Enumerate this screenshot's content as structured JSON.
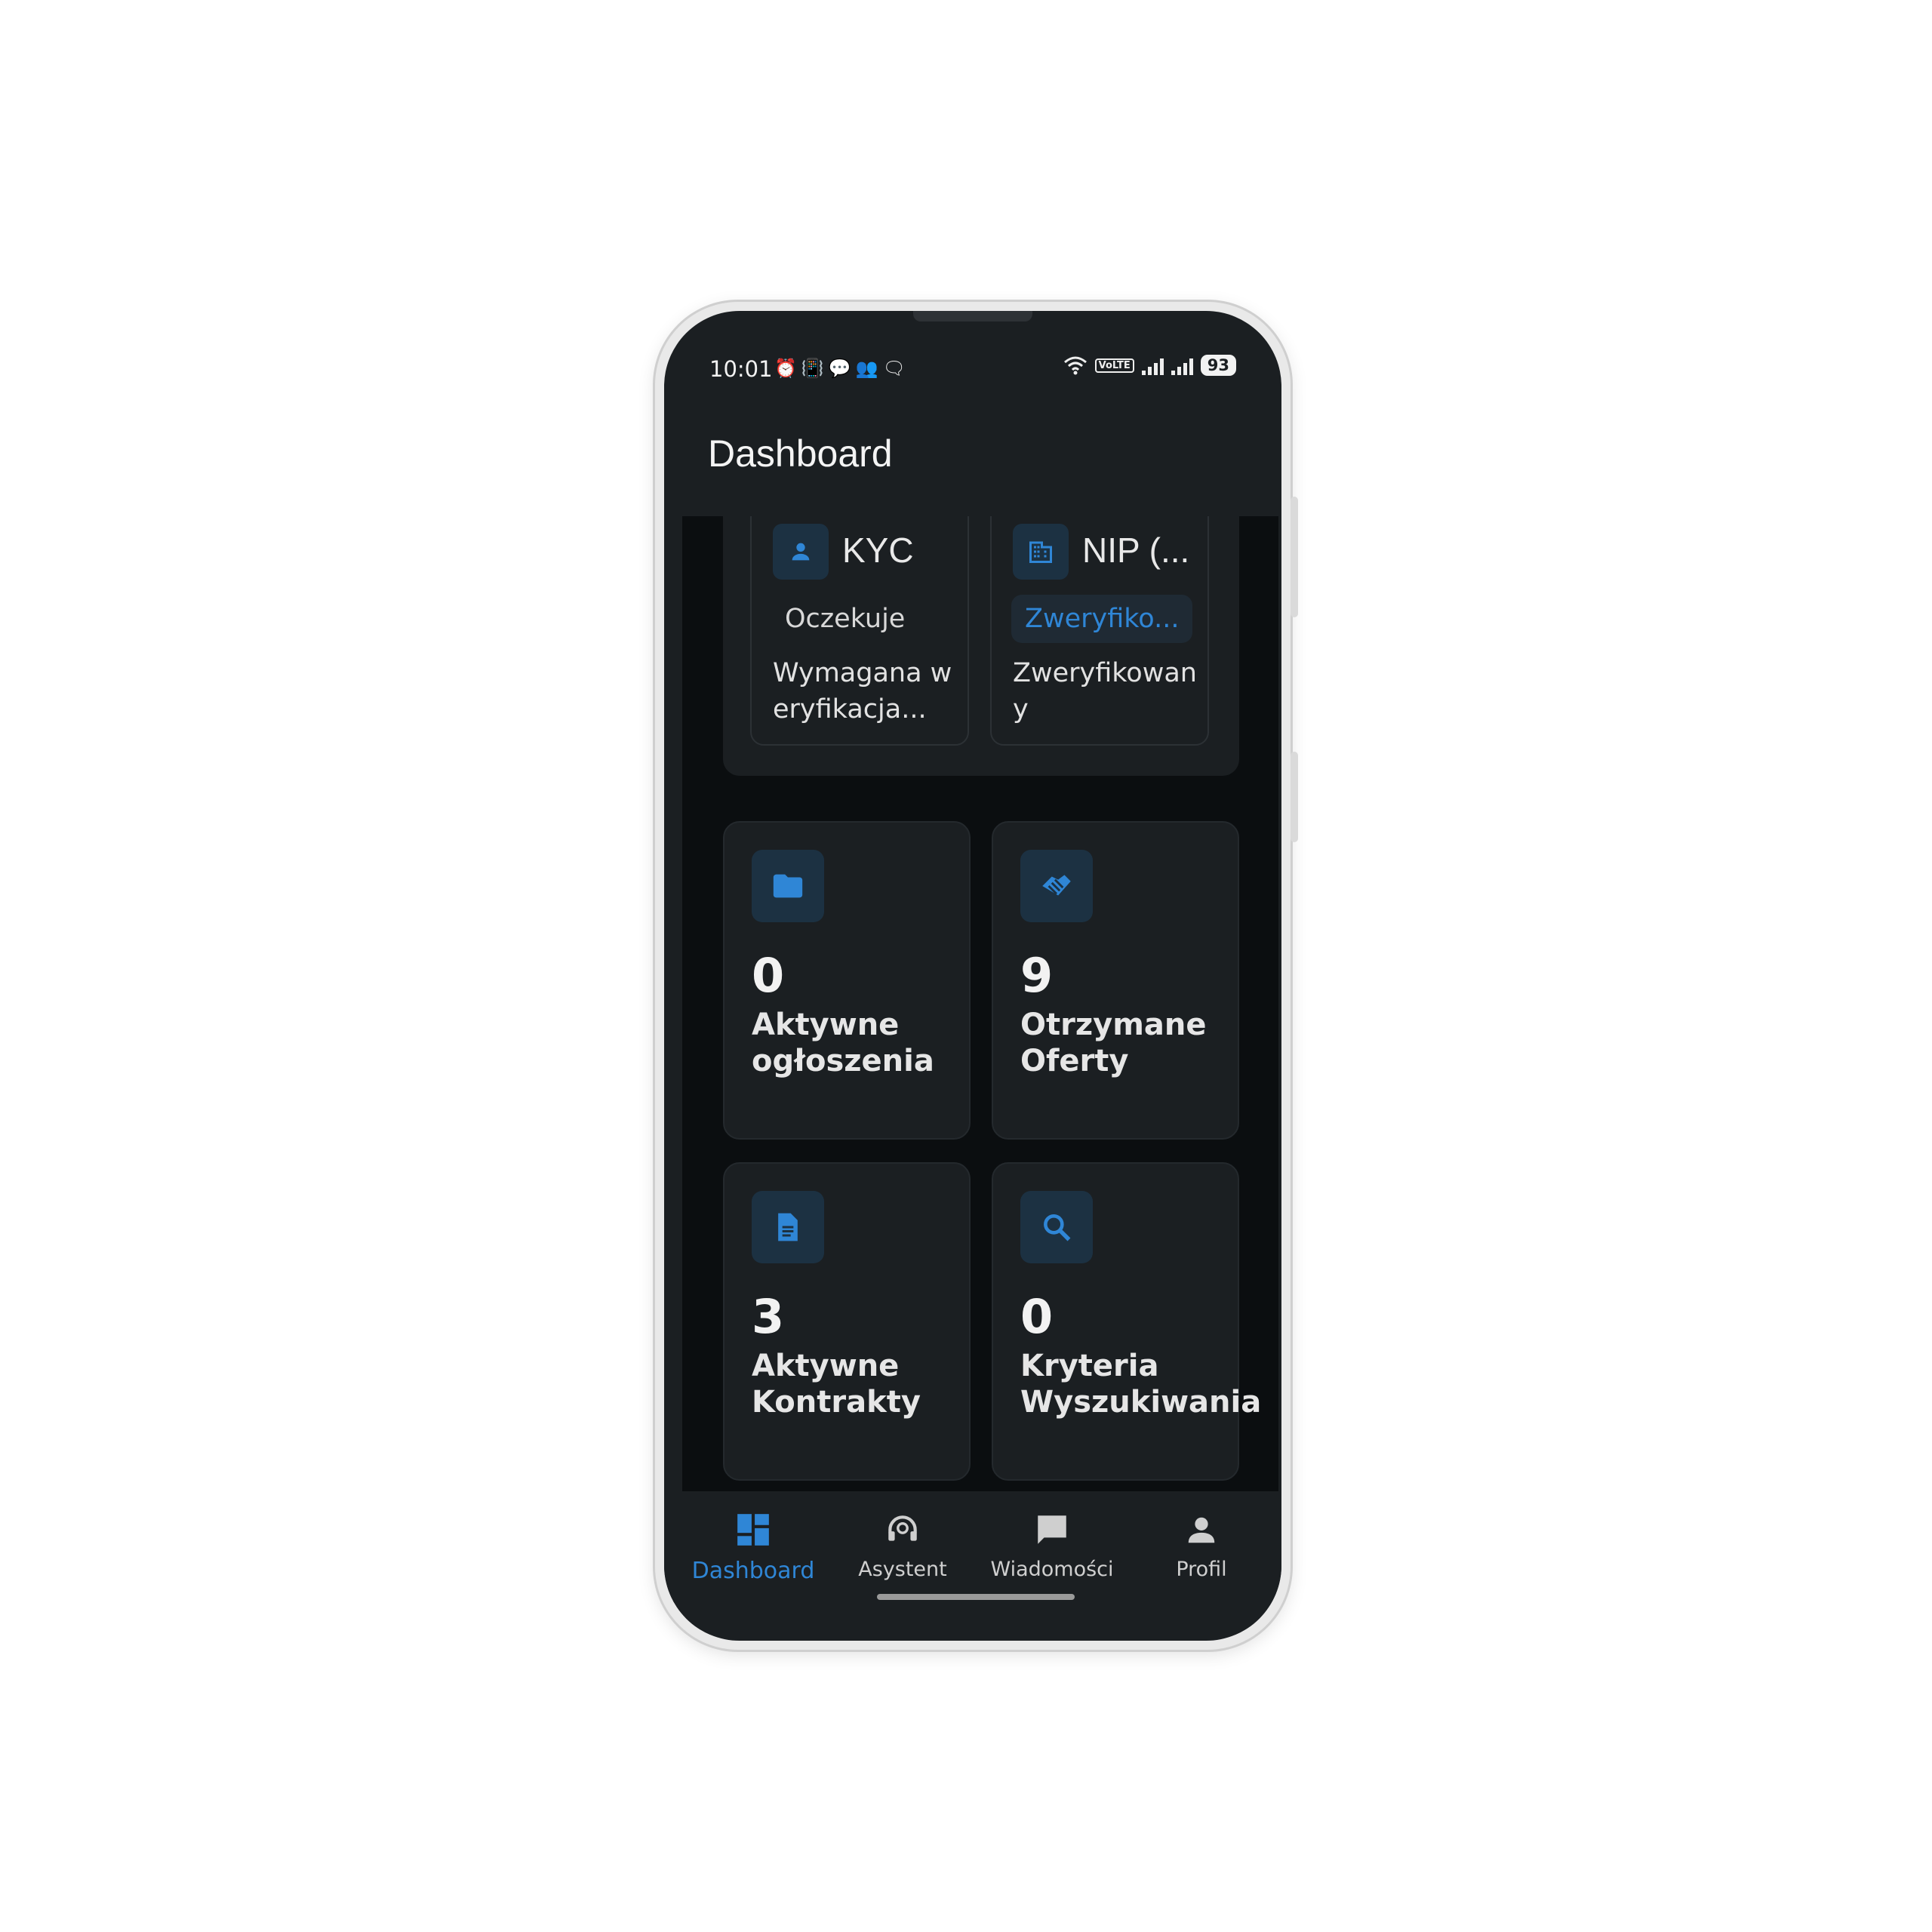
{
  "status_bar": {
    "time": "10:01",
    "left_icons": [
      "alarm-icon",
      "vibrate-icon",
      "chat-bubble-icon",
      "group-icon",
      "message-icon"
    ],
    "right_icons": [
      "wifi-icon",
      "volte-icon",
      "signal-icon",
      "signal-icon"
    ],
    "volte": "VoLTE",
    "battery": "93"
  },
  "app_bar": {
    "title": "Dashboard"
  },
  "verification": {
    "kyc": {
      "title": "KYC",
      "status": "Oczekuje",
      "description": "Wymagana weryfikacja..."
    },
    "nip": {
      "title": "NIP (...",
      "status": "Zweryfiko...",
      "description": "Zweryfikowany"
    }
  },
  "stats": [
    {
      "icon": "folder-icon",
      "value": "0",
      "label": "Aktywne ogłoszenia"
    },
    {
      "icon": "handshake-icon",
      "value": "9",
      "label": "Otrzymane Oferty"
    },
    {
      "icon": "document-icon",
      "value": "3",
      "label": "Aktywne Kontrakty"
    },
    {
      "icon": "search-icon",
      "value": "0",
      "label": "Kryteria Wyszukiwania"
    }
  ],
  "nav": [
    {
      "label": "Dashboard",
      "icon": "dashboard-icon",
      "active": true
    },
    {
      "label": "Asystent",
      "icon": "headset-icon",
      "active": false
    },
    {
      "label": "Wiadomości",
      "icon": "chat-icon",
      "active": false
    },
    {
      "label": "Profil",
      "icon": "person-icon",
      "active": false
    }
  ],
  "colors": {
    "accent": "#2f86d6",
    "surface": "#1b1f22",
    "background": "#0b0e10",
    "icon_bg": "#1c3142"
  }
}
